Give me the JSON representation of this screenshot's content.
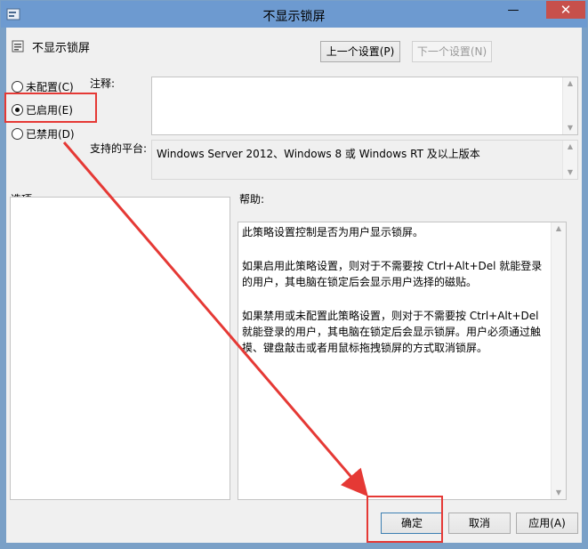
{
  "window": {
    "title": "不显示锁屏",
    "minimize_glyph": "—",
    "close_glyph": "✕"
  },
  "header": {
    "policy_name": "不显示锁屏",
    "prev_setting": "上一个设置(P)",
    "next_setting": "下一个设置(N)"
  },
  "state": {
    "options": [
      {
        "label": "未配置(C)",
        "selected": false
      },
      {
        "label": "已启用(E)",
        "selected": true
      },
      {
        "label": "已禁用(D)",
        "selected": false
      }
    ]
  },
  "comment": {
    "label": "注释:",
    "value": ""
  },
  "platform": {
    "label": "支持的平台:",
    "value": "Windows Server 2012、Windows 8 或 Windows RT 及以上版本"
  },
  "options_panel": {
    "label": "选项:"
  },
  "help_panel": {
    "label": "帮助:",
    "paragraphs": [
      "此策略设置控制是否为用户显示锁屏。",
      "如果启用此策略设置，则对于不需要按 Ctrl+Alt+Del 就能登录的用户，其电脑在锁定后会显示用户选择的磁贴。",
      "如果禁用或未配置此策略设置，则对于不需要按 Ctrl+Alt+Del 就能登录的用户，其电脑在锁定后会显示锁屏。用户必须通过触摸、键盘敲击或者用鼠标拖拽锁屏的方式取消锁屏。"
    ]
  },
  "footer": {
    "ok": "确定",
    "cancel": "取消",
    "apply": "应用(A)"
  },
  "annotation": {
    "color": "#e53935"
  }
}
